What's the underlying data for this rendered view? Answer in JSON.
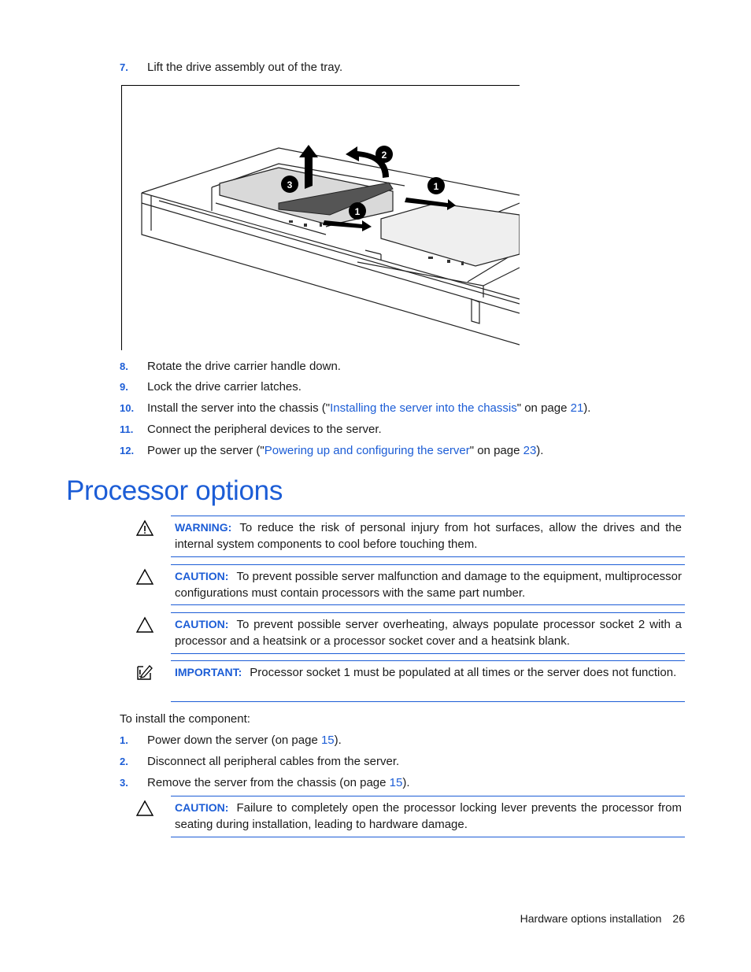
{
  "steps_top": [
    {
      "num": "7.",
      "text": "Lift the drive assembly out of the tray."
    }
  ],
  "figure": {
    "callouts": [
      "1",
      "2",
      "3",
      "1"
    ],
    "description": "Drive assembly being lifted out of tray"
  },
  "steps_after_figure": [
    {
      "num": "8.",
      "text": "Rotate the drive carrier handle down."
    },
    {
      "num": "9.",
      "text": "Lock the drive carrier latches."
    },
    {
      "num": "10.",
      "pre": "Install the server into the chassis (\"",
      "link": "Installing the server into the chassis",
      "mid": "\" on page ",
      "page": "21",
      "post": ")."
    },
    {
      "num": "11.",
      "text": "Connect the peripheral devices to the server."
    },
    {
      "num": "12.",
      "pre": "Power up the server (\"",
      "link": "Powering up and configuring the server",
      "mid": "\" on page ",
      "page": "23",
      "post": ")."
    }
  ],
  "section_title": "Processor options",
  "notes": [
    {
      "type": "warning",
      "icon": "warning-icon",
      "label": "WARNING:",
      "text": "To reduce the risk of personal injury from hot surfaces, allow the drives and the internal system components to cool before touching them."
    },
    {
      "type": "caution",
      "icon": "caution-icon",
      "label": "CAUTION:",
      "text": "To prevent possible server malfunction and damage to the equipment, multiprocessor configurations must contain processors with the same part number."
    },
    {
      "type": "caution",
      "icon": "caution-icon",
      "label": "CAUTION:",
      "text": "To prevent possible server overheating, always populate processor socket 2 with a processor and a heatsink or a processor socket cover and a heatsink blank."
    },
    {
      "type": "important",
      "icon": "important-icon",
      "label": "IMPORTANT:",
      "text": "Processor socket 1 must be populated at all times or the server does not function."
    }
  ],
  "intro": "To install the component:",
  "install_steps": [
    {
      "num": "1.",
      "pre": "Power down the server (on page ",
      "page": "15",
      "post": ")."
    },
    {
      "num": "2.",
      "text": "Disconnect all peripheral cables from the server."
    },
    {
      "num": "3.",
      "pre": "Remove the server from the chassis (on page ",
      "page": "15",
      "post": ")."
    }
  ],
  "final_note": {
    "type": "caution",
    "icon": "caution-icon",
    "label": "CAUTION:",
    "text": "Failure to completely open the processor locking lever prevents the processor from seating during installation, leading to hardware damage."
  },
  "footer": {
    "section": "Hardware options installation",
    "page": "26"
  }
}
